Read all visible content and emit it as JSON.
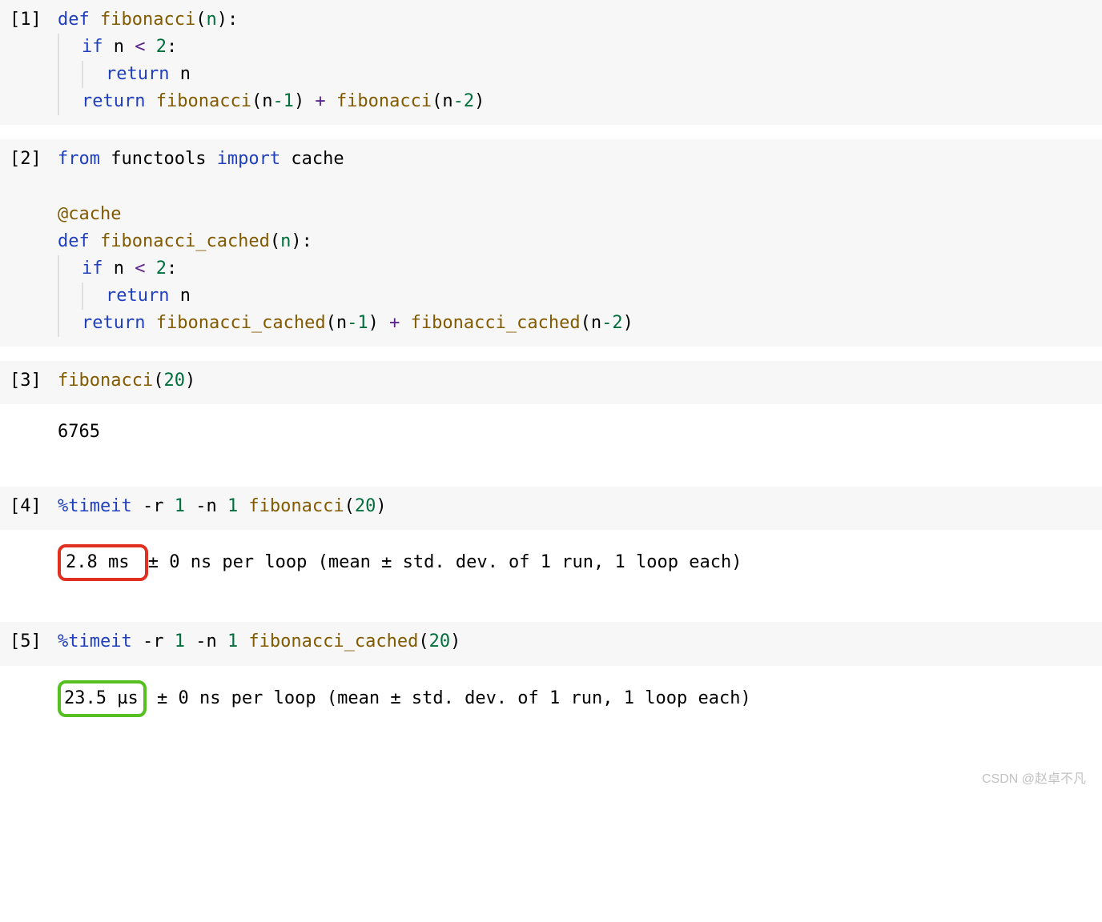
{
  "cells": {
    "c1_prompt": "[1]",
    "c1_line1_def": "def",
    "c1_line1_name": "fibonacci",
    "c1_line1_paren_open": "(",
    "c1_line1_param": "n",
    "c1_line1_paren_close": ")",
    "c1_line1_colon": ":",
    "c1_line2_if": "if",
    "c1_line2_cond": " n ",
    "c1_line2_lt": "<",
    "c1_line2_two": " 2",
    "c1_line2_colon": ":",
    "c1_line3_return": "return",
    "c1_line3_val": " n",
    "c1_line4_return": "return",
    "c1_line4_call1": " fibonacci",
    "c1_line4_po1": "(",
    "c1_line4_n1": "n",
    "c1_line4_m1": "-1",
    "c1_line4_pc1": ")",
    "c1_line4_plus": " + ",
    "c1_line4_call2": "fibonacci",
    "c1_line4_po2": "(",
    "c1_line4_n2": "n",
    "c1_line4_m2": "-2",
    "c1_line4_pc2": ")",
    "c2_prompt": "[2]",
    "c2_line1_from": "from",
    "c2_line1_mod": " functools ",
    "c2_line1_import": "import",
    "c2_line1_name": " cache",
    "c2_line3_at": "@",
    "c2_line3_dec": "cache",
    "c2_line4_def": "def",
    "c2_line4_name": "fibonacci_cached",
    "c2_line4_po": "(",
    "c2_line4_param": "n",
    "c2_line4_pc": ")",
    "c2_line4_colon": ":",
    "c2_line5_if": "if",
    "c2_line5_cond": " n ",
    "c2_line5_lt": "<",
    "c2_line5_two": " 2",
    "c2_line5_colon": ":",
    "c2_line6_return": "return",
    "c2_line6_val": " n",
    "c2_line7_return": "return",
    "c2_line7_call1": " fibonacci_cached",
    "c2_line7_po1": "(",
    "c2_line7_n1": "n",
    "c2_line7_m1": "-1",
    "c2_line7_pc1": ")",
    "c2_line7_plus": " + ",
    "c2_line7_call2": "fibonacci_cached",
    "c2_line7_po2": "(",
    "c2_line7_n2": "n",
    "c2_line7_m2": "-2",
    "c2_line7_pc2": ")",
    "c3_prompt": "[3]",
    "c3_call": "fibonacci",
    "c3_po": "(",
    "c3_arg": "20",
    "c3_pc": ")",
    "c3_out": "6765",
    "c4_prompt": "[4]",
    "c4_timeit": "%timeit",
    "c4_r": " -r ",
    "c4_r_v": "1",
    "c4_n": " -n ",
    "c4_n_v": "1",
    "c4_call": " fibonacci",
    "c4_po": "(",
    "c4_arg": "20",
    "c4_pc": ")",
    "c4_out_hl": "2.8 ms ",
    "c4_out_rest": "± 0 ns per loop (mean ± std. dev. of 1 run, 1 loop each)",
    "c5_prompt": "[5]",
    "c5_timeit": "%timeit",
    "c5_r": " -r ",
    "c5_r_v": "1",
    "c5_n": " -n ",
    "c5_n_v": "1",
    "c5_call": " fibonacci_cached",
    "c5_po": "(",
    "c5_arg": "20",
    "c5_pc": ")",
    "c5_out_hl": "23.5 µs",
    "c5_out_rest": " ± 0 ns per loop (mean ± std. dev. of 1 run, 1 loop each)"
  },
  "footer": "CSDN @赵卓不凡"
}
